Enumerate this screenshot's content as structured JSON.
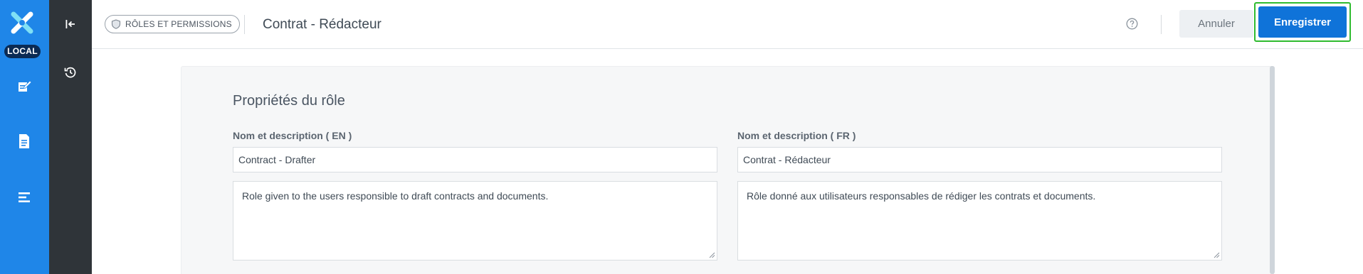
{
  "app": {
    "environment_badge": "LOCAL",
    "brand_color": "#1f86e8",
    "accent_color": "#0f73d9"
  },
  "rail": {
    "items": [
      {
        "icon": "edit-document-icon"
      },
      {
        "icon": "document-icon"
      },
      {
        "icon": "list-icon"
      }
    ]
  },
  "subrail": {
    "items": [
      {
        "icon": "collapse-left-icon"
      },
      {
        "icon": "history-icon"
      }
    ]
  },
  "header": {
    "breadcrumb": "RÔLES ET PERMISSIONS",
    "title": "Contrat - Rédacteur",
    "help_icon": "help-circle-icon",
    "cancel_label": "Annuler",
    "save_label": "Enregistrer"
  },
  "form": {
    "section_title": "Propriétés du rôle",
    "en": {
      "label": "Nom et description ( EN )",
      "name_value": "Contract - Drafter",
      "description_value": "Role given to the users responsible to draft contracts and documents."
    },
    "fr": {
      "label": "Nom et description ( FR )",
      "name_value": "Contrat - Rédacteur",
      "description_value": "Rôle donné aux utilisateurs responsables de rédiger les contrats et documents."
    }
  }
}
